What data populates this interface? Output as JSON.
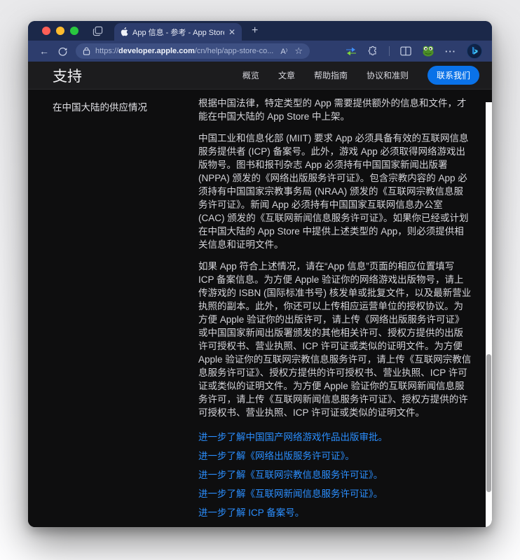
{
  "browser": {
    "tab_title": "App 信息 - 参考 - App Store Co",
    "tab_close": "✕",
    "new_tab": "+",
    "back": "←",
    "url_scheme": "https://",
    "url_domain": "developer.apple.com",
    "url_path": "/cn/help/app-store-co...",
    "read_aloud": "A⁾",
    "star": "☆",
    "more": "···",
    "icons": {
      "traffic": [
        "close-red",
        "minimize-yellow",
        "zoom-green"
      ],
      "tab_actions": "stacked-tabs",
      "favicon": "apple-logo",
      "refresh": "reload-circle-arrow",
      "lock": "padlock",
      "extension_1": "blue-green-arrows",
      "extension_2": "puzzle-piece",
      "split_screen": "split-window",
      "extension_3": "frog-face",
      "bing": "bing-b-logo"
    },
    "colors": {
      "tabbar": "#1b2849",
      "toolbar": "#2d3d6d",
      "address_pill": "#3d4f82"
    }
  },
  "site_header": {
    "title": "支持",
    "nav": [
      "概览",
      "文章",
      "帮助指南",
      "协议和准则"
    ],
    "contact_button": "联系我们",
    "accent_color": "#0a72e8"
  },
  "sidebar": {
    "items": [
      "在中国大陆的供应情况"
    ]
  },
  "content": {
    "paragraphs": [
      "根据中国法律，特定类型的 App 需要提供额外的信息和文件，才能在中国大陆的 App Store 中上架。",
      "中国工业和信息化部 (MIIT) 要求 App 必须具备有效的互联网信息服务提供者 (ICP) 备案号。此外，游戏 App 必须取得网络游戏出版物号。图书和报刊杂志 App 必须持有中国国家新闻出版署 (NPPA) 颁发的《网络出版服务许可证》。包含宗教内容的 App 必须持有中国国家宗教事务局 (NRAA) 颁发的《互联网宗教信息服务许可证》。新闻 App 必须持有中国国家互联网信息办公室 (CAC) 颁发的《互联网新闻信息服务许可证》。如果你已经或计划在中国大陆的 App Store 中提供上述类型的 App，则必须提供相关信息和证明文件。",
      "如果 App 符合上述情况，请在“App 信息”页面的相应位置填写 ICP 备案信息。为方便 Apple 验证你的网络游戏出版物号，请上传游戏的 ISBN (国际标准书号) 核发单或批复文件，以及最新营业执照的副本。此外，你还可以上传相应运营单位的授权协议。为方便 Apple 验证你的出版许可，请上传《网络出版服务许可证》或中国国家新闻出版署颁发的其他相关许可、授权方提供的出版许可授权书、营业执照、ICP 许可证或类似的证明文件。为方便 Apple 验证你的互联网宗教信息服务许可，请上传《互联网宗教信息服务许可证》、授权方提供的许可授权书、营业执照、ICP 许可证或类似的证明文件。为方便 Apple 验证你的互联网新闻信息服务许可，请上传《互联网新闻信息服务许可证》、授权方提供的许可授权书、营业执照、ICP 许可证或类似的证明文件。"
    ],
    "links": [
      "进一步了解中国国产网络游戏作品出版审批。",
      "进一步了解《网络出版服务许可证》。",
      "进一步了解《互联网宗教信息服务许可证》。",
      "进一步了解《互联网新闻信息服务许可证》。",
      "进一步了解 ICP 备案号。"
    ],
    "link_color": "#2b8fff"
  }
}
